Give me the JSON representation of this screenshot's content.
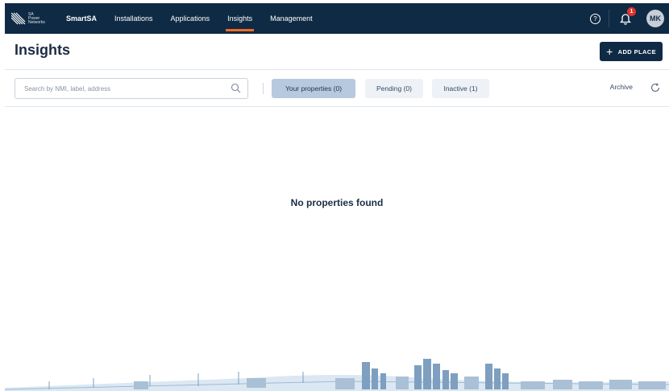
{
  "nav": {
    "logo_text": [
      "SA",
      "Power",
      "Networks"
    ],
    "brand": "SmartSA",
    "items": [
      {
        "label": "Installations",
        "active": false
      },
      {
        "label": "Applications",
        "active": false
      },
      {
        "label": "Insights",
        "active": true
      },
      {
        "label": "Management",
        "active": false
      }
    ],
    "help_icon": "help-circle-icon",
    "notification_icon": "bell-icon",
    "notification_count": "1",
    "avatar_initials": "MK"
  },
  "header": {
    "title": "Insights",
    "add_button_label": "ADD PLACE"
  },
  "toolbar": {
    "search_placeholder": "Search by NMI, label, address",
    "tabs": [
      {
        "label": "Your properties (0)",
        "active": true
      },
      {
        "label": "Pending (0)",
        "active": false
      },
      {
        "label": "Inactive (1)",
        "active": false
      }
    ],
    "archive_label": "Archive"
  },
  "main": {
    "empty_message": "No properties found"
  },
  "colors": {
    "nav_bg": "#0f2a44",
    "accent": "#f26a21",
    "badge": "#e0322d",
    "active_tab": "#b7c9de"
  }
}
